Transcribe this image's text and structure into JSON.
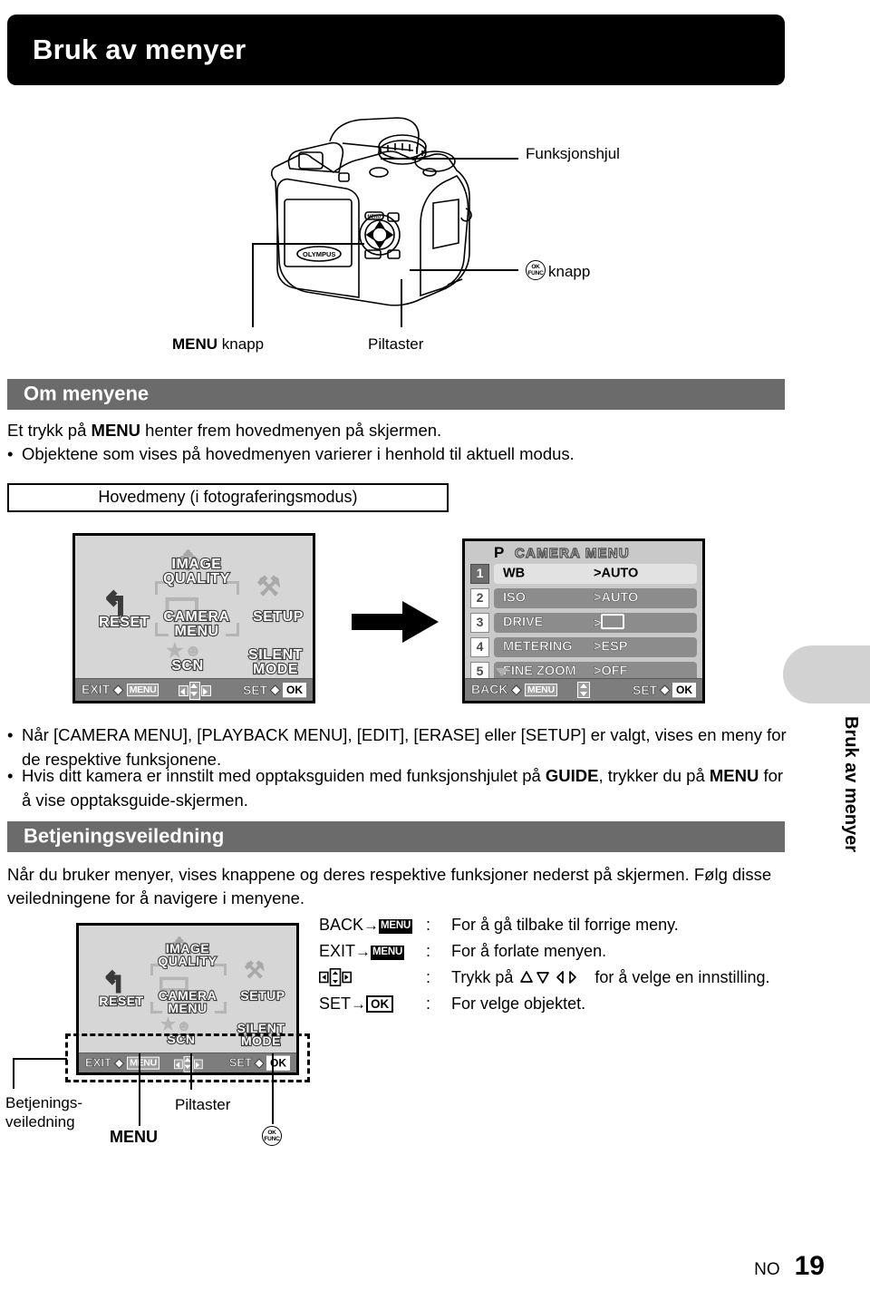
{
  "header": {
    "title": "Bruk av menyer"
  },
  "side_tab": {
    "label": "Bruk av menyer"
  },
  "camera_diagram": {
    "callouts": {
      "mode_dial": "Funksjonshjul",
      "ok_button": "knapp",
      "ok_icon_top": "OK",
      "ok_icon_bottom": "FUNC",
      "menu_button_bold": "MENU",
      "menu_button_rest": " knapp",
      "arrow_pad": "Piltaster"
    },
    "body_text": "OLYMPUS"
  },
  "section_about": {
    "heading": "Om menyene",
    "line1_pre": "Et trykk på ",
    "line1_bold": "MENU",
    "line1_post": " henter frem hovedmenyen på skjermen.",
    "bullet1": "Objektene som vises på hovedmenyen varierer i henhold til aktuell modus.",
    "caption_box": "Hovedmeny (i fotograferingsmodus)"
  },
  "main_menu_screen": {
    "items": [
      {
        "label": "RESET"
      },
      {
        "label": "IMAGE\nQUALITY"
      },
      {
        "label": "CAMERA\nMENU"
      },
      {
        "label": "SETUP"
      },
      {
        "label": "SCN"
      },
      {
        "label": "SILENT\nMODE"
      }
    ],
    "bottom_bar": {
      "left_text": "EXIT",
      "left_arrow": "◆",
      "left_chip": "MENU",
      "right_text": "SET",
      "right_arrow": "◆",
      "right_chip": "OK"
    }
  },
  "camera_menu_screen": {
    "mode": "P",
    "title": "CAMERA MENU",
    "rows": [
      {
        "num": "1",
        "label": "WB",
        "value": "AUTO",
        "selected": true
      },
      {
        "num": "2",
        "label": "ISO",
        "value": "AUTO",
        "selected": false
      },
      {
        "num": "3",
        "label": "DRIVE",
        "value": "",
        "selected": false
      },
      {
        "num": "4",
        "label": "METERING",
        "value": "ESP",
        "selected": false
      },
      {
        "num": "5",
        "label": "FINE ZOOM",
        "value": "OFF",
        "selected": false
      }
    ],
    "bottom_bar": {
      "left_text": "BACK",
      "left_arrow": "◆",
      "left_chip": "MENU",
      "right_text": "SET",
      "right_arrow": "◆",
      "right_chip": "OK"
    }
  },
  "notes": {
    "bullet1": "Når [CAMERA MENU], [PLAYBACK MENU], [EDIT], [ERASE] eller [SETUP] er valgt, vises en meny for de respektive funksjonene.",
    "bullet2_a": "Hvis ditt kamera er innstilt med opptaksguiden med funksjonshjulet på ",
    "bullet2_b": "GUIDE",
    "bullet2_c": ", trykker du på ",
    "bullet2_d": "MENU",
    "bullet2_e": " for å vise opptaksguide-skjermen."
  },
  "section_guide": {
    "heading": "Betjeningsveiledning",
    "paragraph": "Når du bruker menyer, vises knappene og deres respektive funksjoner nederst på skjermen. Følg disse veiledningene for å navigere i menyene."
  },
  "legend": {
    "rows": [
      {
        "key_text": "BACK",
        "key_arrow": "→",
        "key_chip": "MENU",
        "chip_type": "menu",
        "colon": ":",
        "value": "For å gå tilbake til forrige meny."
      },
      {
        "key_text": "EXIT",
        "key_arrow": "→",
        "key_chip": "MENU",
        "chip_type": "menu",
        "colon": ":",
        "value": "For å forlate menyen."
      },
      {
        "key_text": "",
        "key_arrow": "",
        "key_chip": "",
        "chip_type": "pad",
        "colon": ":",
        "value_pre": "Trykk på ",
        "value_post": " for å velge en innstilling."
      },
      {
        "key_text": "SET",
        "key_arrow": "→",
        "key_chip": "OK",
        "chip_type": "ok",
        "colon": ":",
        "value": "For velge objektet."
      }
    ]
  },
  "bottom_callouts": {
    "guide_label": "Betjenings-\nveiledning",
    "menu_label": "MENU",
    "arrows_label": "Piltaster",
    "ok_icon_top": "OK",
    "ok_icon_bottom": "FUNC"
  },
  "footer": {
    "locale": "NO",
    "page": "19"
  },
  "colors": {
    "title_bg": "#000000",
    "section_bg": "#6b6b6b",
    "lcd_bg": "#d6d6d6",
    "lcd_bar": "#7d7d7d",
    "row_bar": "#8c8c8c",
    "row_selected": "#e2e2e2",
    "side_tab": "#d2d2d2"
  }
}
